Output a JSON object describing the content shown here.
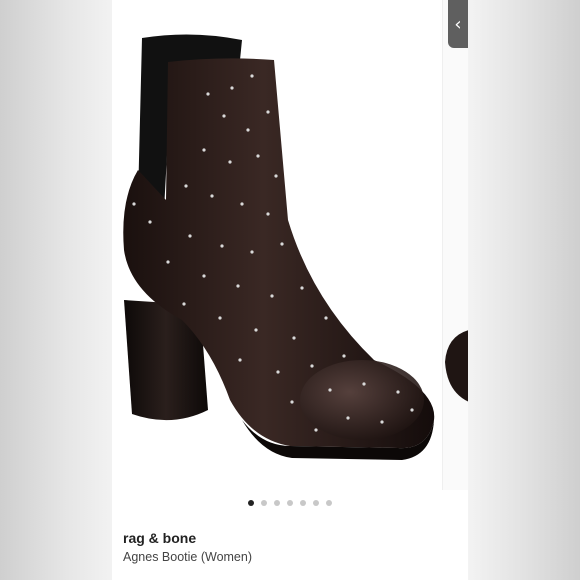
{
  "carousel": {
    "slide_count": 7,
    "active_index": 0,
    "prev_icon": "chevron-left-icon"
  },
  "product": {
    "brand": "rag & bone",
    "name": "Agnes Bootie (Women)"
  },
  "image": {
    "subject": "black leather studded ankle boot",
    "leather_color": "#2b1d1a",
    "stud_color": "#d9d9d9"
  }
}
